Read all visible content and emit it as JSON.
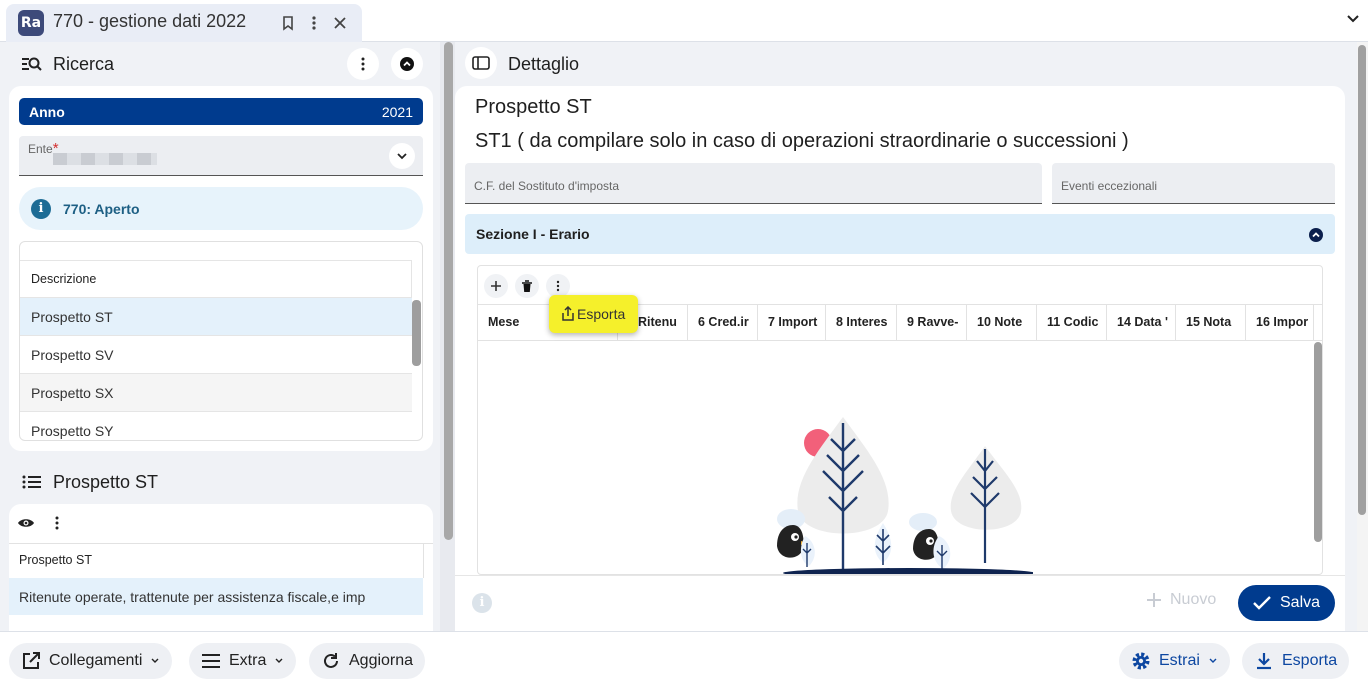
{
  "tab": {
    "logo": "Ra",
    "title": "770 - gestione dati 2022"
  },
  "ricerca": {
    "title": "Ricerca",
    "anno_label": "Anno",
    "anno_value": "2021",
    "ente_label": "Ente",
    "ente_required": "*",
    "status": "770: Aperto",
    "list_header": "Descrizione",
    "list_items": [
      "Prospetto ST",
      "Prospetto SV",
      "Prospetto SX",
      "Prospetto SY"
    ]
  },
  "prospetto_panel": {
    "title": "Prospetto ST",
    "col_header": "Prospetto ST",
    "row_text": "Ritenute operate, trattenute per assistenza fiscale,e imp"
  },
  "dettaglio": {
    "title": "Dettaglio",
    "heading": "Prospetto ST",
    "subheading": "ST1 ( da compilare solo in caso di operazioni straordinarie o successioni )",
    "field_cf": "C.F. del Sostituto d'imposta",
    "field_eventi": "Eventi eccezionali",
    "section": "Sezione I - Erario",
    "columns": [
      "Mese",
      "Ritenu",
      "6 Cred.ir",
      "7 Import",
      "8 Interes",
      "9 Ravve-",
      "10 Note",
      "11 Codic",
      "14 Data '",
      "15 Nota",
      "16 Impor"
    ],
    "tooltip": "Esporta",
    "btn_nuovo": "Nuovo",
    "btn_salva": "Salva"
  },
  "footer": {
    "collegamenti": "Collegamenti",
    "extra": "Extra",
    "aggiorna": "Aggiorna",
    "estrai": "Estrai",
    "esporta": "Esporta"
  },
  "colors": {
    "primary": "#003b8e",
    "info_bg": "#e7f3fb",
    "section_bg": "#ddeefa",
    "tooltip": "#f5f02b"
  }
}
